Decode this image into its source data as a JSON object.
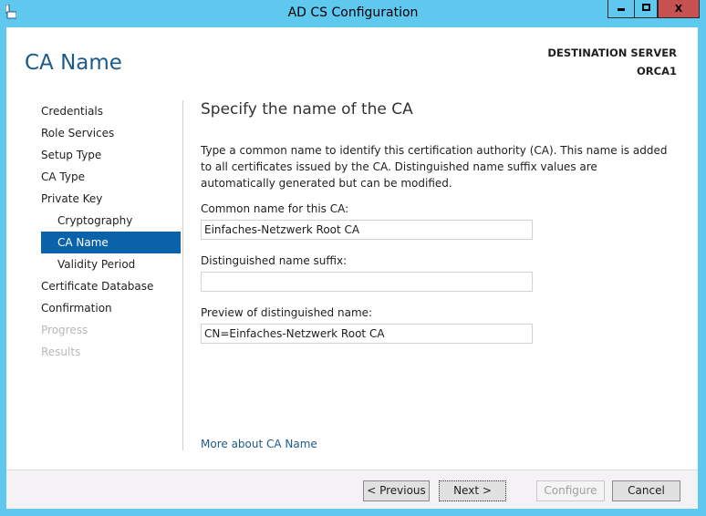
{
  "window": {
    "title": "AD CS Configuration",
    "minimize": "▁",
    "maximize": "□",
    "close": "X"
  },
  "header": {
    "page_title": "CA Name",
    "destination_label": "DESTINATION SERVER",
    "server": "ORCA1"
  },
  "nav": [
    {
      "label": "Credentials",
      "state": "normal"
    },
    {
      "label": "Role Services",
      "state": "normal"
    },
    {
      "label": "Setup Type",
      "state": "normal"
    },
    {
      "label": "CA Type",
      "state": "normal"
    },
    {
      "label": "Private Key",
      "state": "normal"
    },
    {
      "label": "Cryptography",
      "state": "sub"
    },
    {
      "label": "CA Name",
      "state": "selected"
    },
    {
      "label": "Validity Period",
      "state": "sub"
    },
    {
      "label": "Certificate Database",
      "state": "normal"
    },
    {
      "label": "Confirmation",
      "state": "normal"
    },
    {
      "label": "Progress",
      "state": "disabled"
    },
    {
      "label": "Results",
      "state": "disabled"
    }
  ],
  "main": {
    "heading": "Specify the name of the CA",
    "description": "Type a common name to identify this certification authority (CA). This name is added to all certificates issued by the CA. Distinguished name suffix values are automatically generated but can be modified.",
    "common_name_label": "Common name for this CA:",
    "common_name_value": "Einfaches-Netzwerk Root CA",
    "suffix_label": "Distinguished name suffix:",
    "suffix_value": "",
    "preview_label": "Preview of distinguished name:",
    "preview_value": "CN=Einfaches-Netzwerk Root CA",
    "more_link": "More about CA Name"
  },
  "buttons": {
    "previous": "< Previous",
    "next": "Next >",
    "configure": "Configure",
    "cancel": "Cancel"
  }
}
